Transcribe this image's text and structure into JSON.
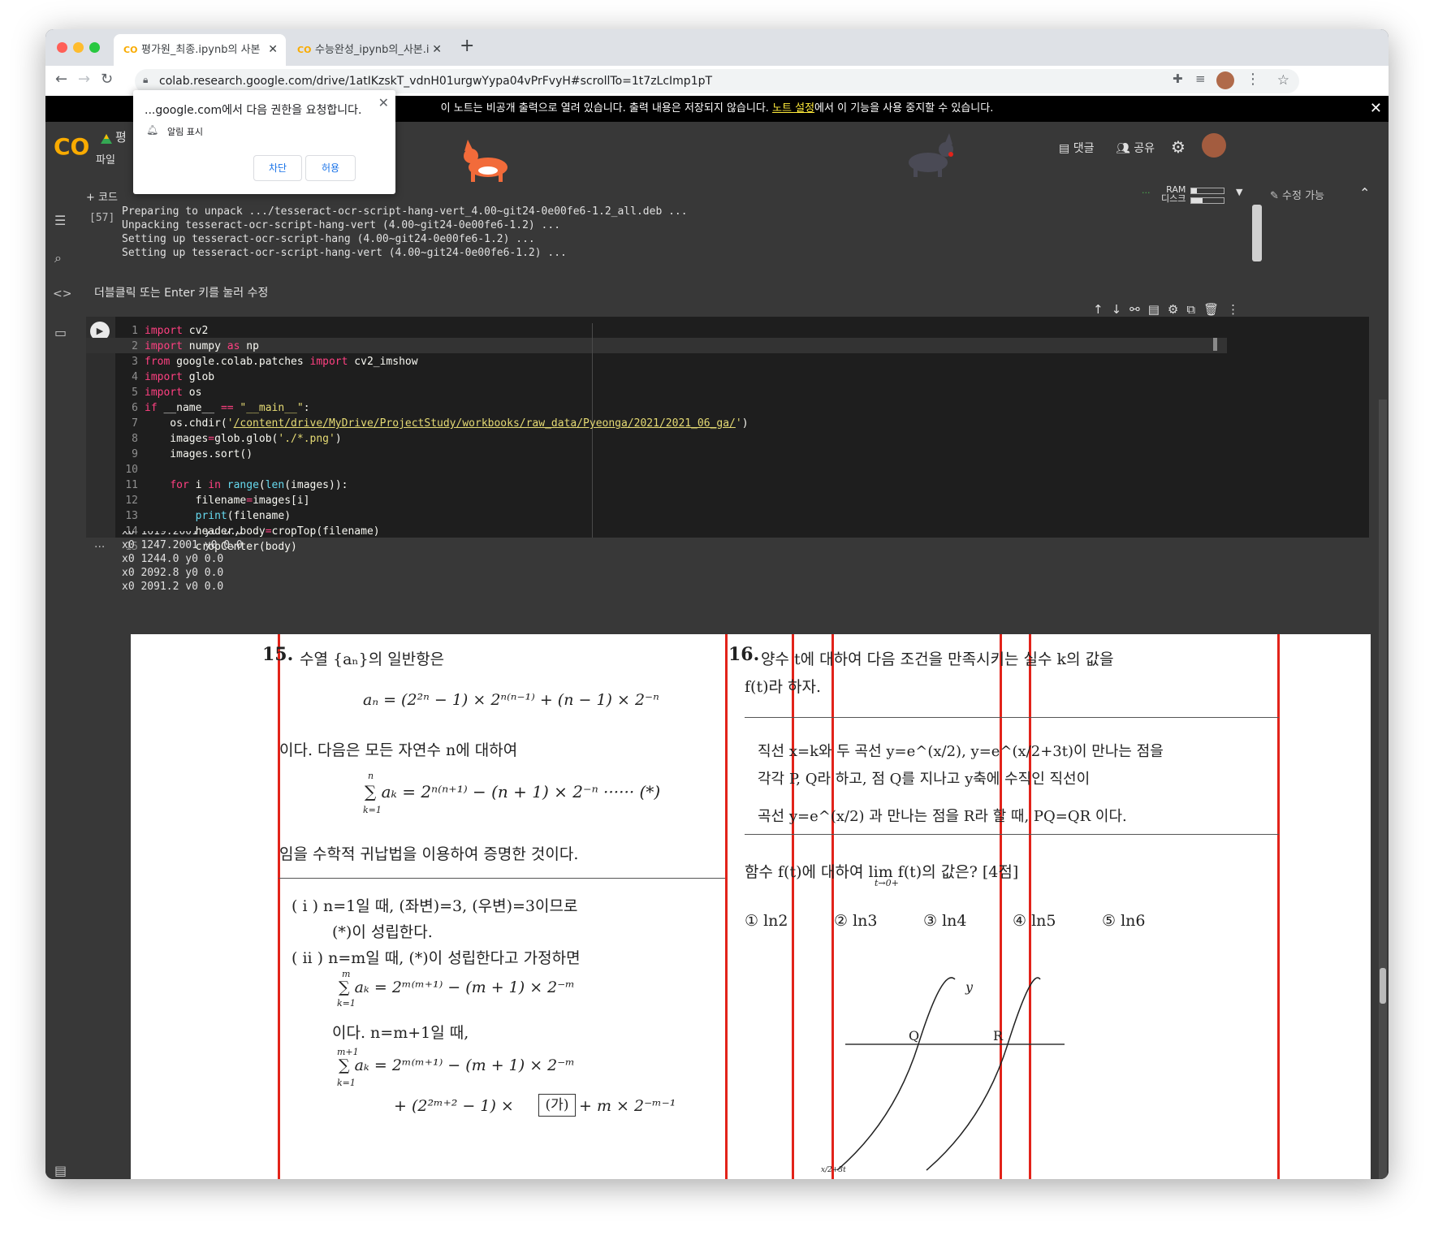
{
  "browser": {
    "tabs": [
      {
        "title": "평가원_최종.ipynb의 사본 - Colab",
        "close": "✕"
      },
      {
        "title": "수능완성_ipynb의_사본.ipynb - C",
        "close": "✕"
      }
    ],
    "new_tab": "+",
    "url": "colab.research.google.com/drive/1atIKzskT_vdnH01urgwYypa04vPrFvyH#scrollTo=1t7zLcImp1pT"
  },
  "permission_popup": {
    "title": "...google.com에서 다음 권한을 요청합니다.",
    "item": "알림 표시",
    "block": "차단",
    "allow": "허용"
  },
  "notice": {
    "text_before": "이 노트는 비공개 출력으로 열려 있습니다. 출력 내용은 저장되지 않습니다.",
    "link": "노트 설정",
    "text_after": "에서 이 기능을 사용 중지할 수 있습니다."
  },
  "colab": {
    "logo": "CO",
    "title_initial": "평",
    "menu_file": "파일",
    "comment": "댓글",
    "share": "공유",
    "add_code": "+ 코드",
    "ram": "RAM",
    "disk": "디스크",
    "edit_mode": "수정 가능",
    "status_dots": "...",
    "run_icon": "▶"
  },
  "prev_output": {
    "exec_count": "[57]",
    "lines": [
      "Preparing to unpack .../tesseract-ocr-script-hang-vert_4.00~git24-0e00fe6-1.2_all.deb ...",
      "Unpacking tesseract-ocr-script-hang-vert (4.00~git24-0e00fe6-1.2) ...",
      "Setting up tesseract-ocr-script-hang (4.00~git24-0e00fe6-1.2) ...",
      "Setting up tesseract-ocr-script-hang-vert (4.00~git24-0e00fe6-1.2) ..."
    ]
  },
  "text_cell": {
    "hint": "더블클릭 또는 Enter 키를 눌러 수정"
  },
  "code": {
    "line_numbers": [
      "1",
      "2",
      "3",
      "4",
      "5",
      "6",
      "7",
      "8",
      "9",
      "10",
      "11",
      "12",
      "13",
      "14",
      "15"
    ]
  },
  "output": {
    "more": "...",
    "lines": [
      "x0 1619.2001 y0 0.0",
      "x0 1247.2001 y0 0.0",
      "x0 1244.0 y0 0.0",
      "x0 2092.8 y0 0.0",
      "x0 2091.2 y0 0.0"
    ]
  },
  "exam": {
    "q15_num": "15.",
    "q15_intro": "수열 {aₙ}의 일반항은",
    "q15_formula1": "aₙ = (2²ⁿ − 1) × 2ⁿ⁽ⁿ⁻¹⁾ + (n − 1) × 2⁻ⁿ",
    "q15_mid": "이다. 다음은 모든 자연수 n에 대하여",
    "q15_formula2": "∑ aₖ = 2ⁿ⁽ⁿ⁺¹⁾ − (n + 1) × 2⁻ⁿ  ······ (*)",
    "q15_sum_top": "n",
    "q15_sum_bottom": "k=1",
    "q15_after": "임을 수학적 귀납법을 이용하여 증명한 것이다.",
    "q15_box1": "( i ) n=1일 때, (좌변)=3, (우변)=3이므로",
    "q15_box2": "(*)이 성립한다.",
    "q15_box3": "( ii ) n=m일 때, (*)이 성립한다고 가정하면",
    "q15_box4": "∑ aₖ = 2ᵐ⁽ᵐ⁺¹⁾ − (m + 1) × 2⁻ᵐ",
    "q15_box4_top": "m",
    "q15_box4_bottom": "k=1",
    "q15_box5": "이다. n=m+1일 때,",
    "q15_box6": "∑ aₖ = 2ᵐ⁽ᵐ⁺¹⁾ − (m + 1) × 2⁻ᵐ",
    "q15_box6_top": "m+1",
    "q15_box6_bottom": "k=1",
    "q15_box7_a": "+ (2²ᵐ⁺² − 1) ×",
    "q15_box7_ga": "(가)",
    "q15_box7_b": "+ m × 2⁻ᵐ⁻¹",
    "q16_num": "16.",
    "q16_line1": "양수 t에 대하여 다음 조건을 만족시키는 실수 k의 값을",
    "q16_line2": "f(t)라 하자.",
    "q16_box1": "직선 x=k와 두 곡선 y=e^(x/2), y=e^(x/2+3t)이 만나는 점을",
    "q16_box2": "각각 P, Q라 하고, 점 Q를 지나고 y축에 수직인 직선이",
    "q16_box3": "곡선 y=e^(x/2) 과 만나는 점을 R라 할 때, PQ=QR 이다.",
    "q16_ask": "함수 f(t)에 대하여 lim f(t)의 값은? [4점]",
    "q16_lim_sub": "t→0+",
    "q16_choices": [
      "① ln2",
      "② ln3",
      "③ ln4",
      "④ ln5",
      "⑤ ln6"
    ],
    "graph_y": "y",
    "graph_q": "Q",
    "graph_r": "R",
    "graph_tick": "x/2+3t"
  },
  "colors": {
    "accent_red": "#e2231a",
    "colab_orange": "#f9ab00",
    "keyword": "#ff4081",
    "string": "#e6db74",
    "builtin": "#66d9ef"
  },
  "icons": [
    "back-icon",
    "forward-icon",
    "reload-icon",
    "lock-icon",
    "star-icon",
    "extensions-icon",
    "media-icon",
    "menu-icon",
    "comment-icon",
    "people-icon",
    "gear-icon",
    "toc-icon",
    "search-icon",
    "code-icon",
    "folder-icon",
    "terminal-icon",
    "bell-icon",
    "close-icon"
  ]
}
